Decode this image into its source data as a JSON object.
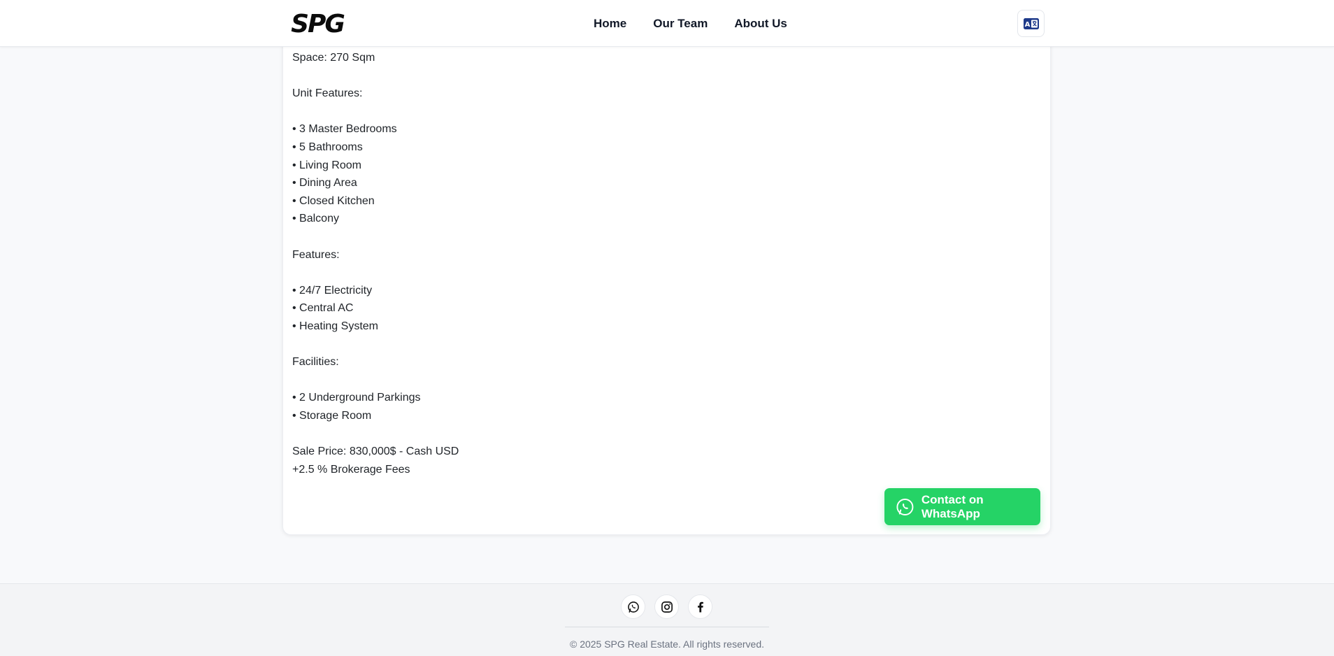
{
  "header": {
    "logo_text": "SPG",
    "nav": [
      {
        "label": "Home"
      },
      {
        "label": "Our Team"
      },
      {
        "label": "About Us"
      }
    ],
    "language_icon": "translate-icon"
  },
  "listing": {
    "lines": [
      "Space: 270 Sqm",
      "",
      "Unit Features:",
      "",
      "• 3 Master Bedrooms",
      "• 5 Bathrooms",
      "• Living Room",
      "• Dining Area",
      "• Closed Kitchen",
      "• Balcony",
      "",
      "Features:",
      "",
      "• 24/7 Electricity",
      "• Central AC",
      "• Heating System",
      "",
      "Facilities:",
      "",
      "• 2 Underground Parkings",
      "• Storage Room",
      "",
      "Sale Price: 830,000$ - Cash USD",
      "+2.5 % Brokerage Fees"
    ],
    "whatsapp_label": "Contact on WhatsApp"
  },
  "footer": {
    "social": [
      "whatsapp-icon",
      "instagram-icon",
      "facebook-icon"
    ],
    "copyright": "© 2025 SPG Real Estate. All rights reserved."
  },
  "colors": {
    "whatsapp_green": "#25d366",
    "page_bg": "#f8f9fb",
    "footer_bg": "#f3f4f6"
  }
}
